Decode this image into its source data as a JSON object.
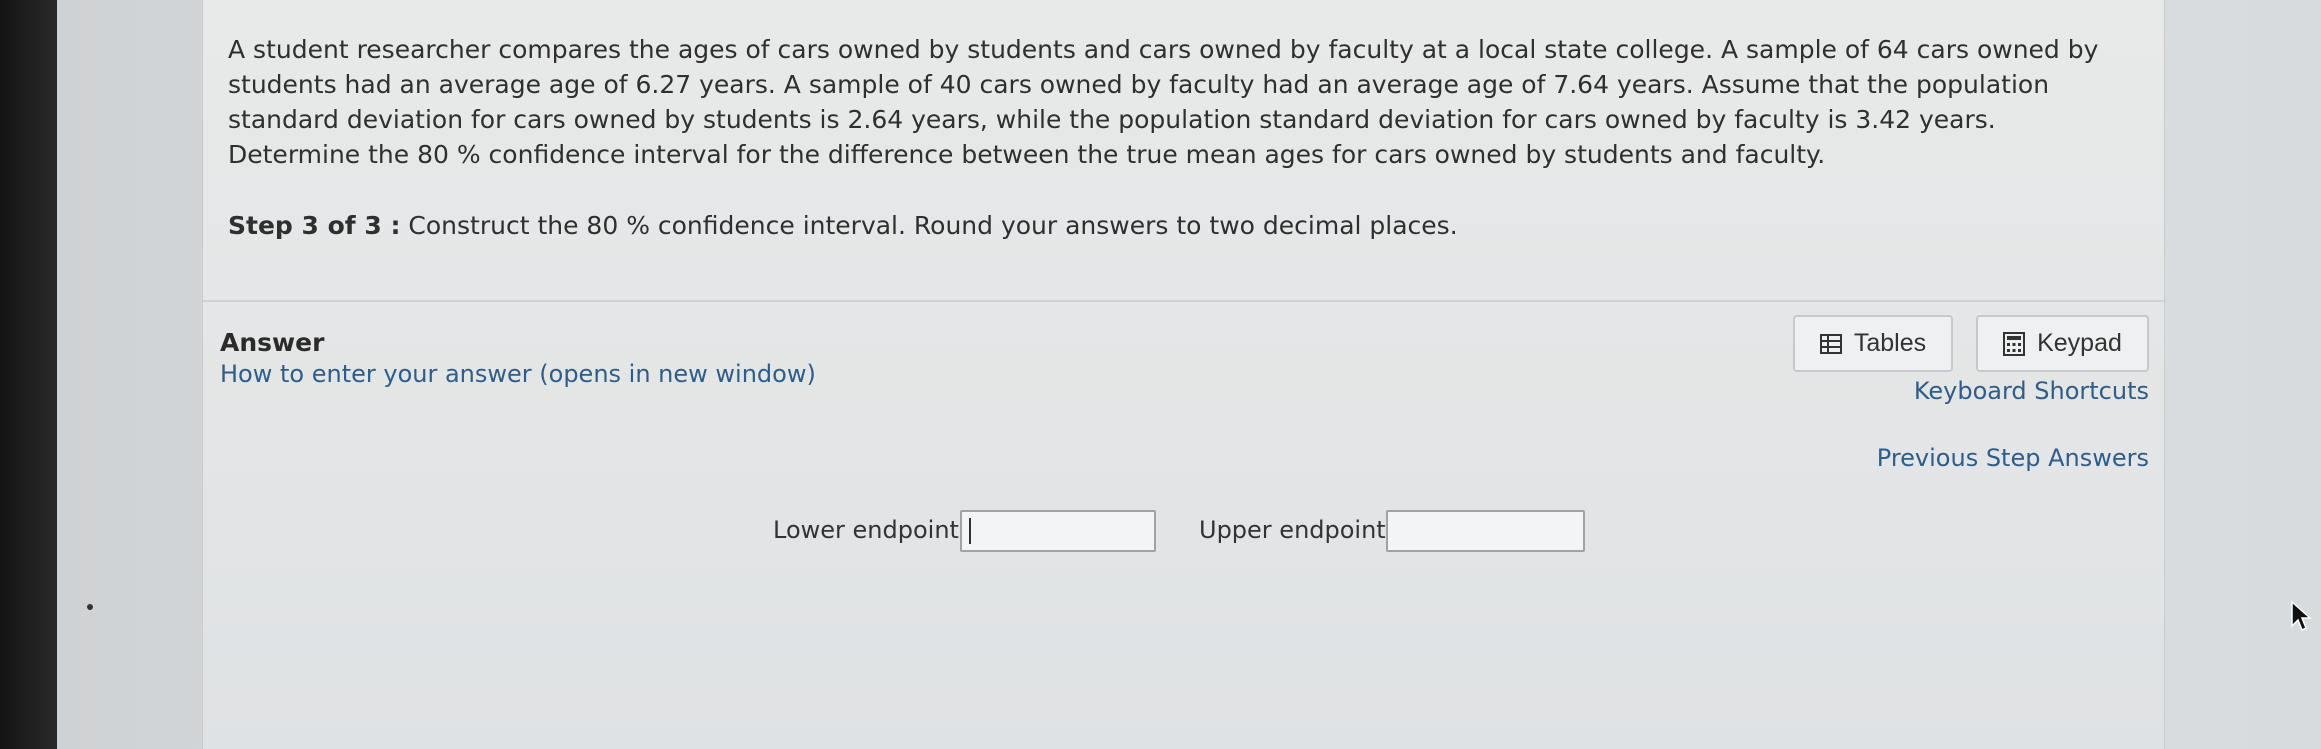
{
  "question": {
    "text": "A student researcher compares the ages of cars owned by students and cars owned by faculty at a local state college.  A sample of 64 cars owned by students had an average age of 6.27 years.  A sample of 40 cars owned by faculty had an average age of 7.64 years.  Assume that the population standard deviation for cars owned by students is 2.64 years, while the population standard deviation for cars owned by faculty is 3.42 years.  Determine the 80 %  confidence interval for the difference between the true mean ages for cars owned by students and faculty.",
    "step_label": "Step 3 of 3 :",
    "step_text": " Construct the 80 %  confidence interval. Round your answers to two decimal places."
  },
  "answer": {
    "title": "Answer",
    "how_to_link": "How to enter your answer (opens in new window)",
    "tables_label": "Tables",
    "keypad_label": "Keypad",
    "keyboard_shortcuts": "Keyboard Shortcuts",
    "previous_step_answers": "Previous Step Answers",
    "lower_label": "Lower endpoint:",
    "lower_value": "",
    "upper_label": "Upper endpoint:",
    "upper_value": ""
  },
  "icons": {
    "tables": "table-grid-icon",
    "keypad": "calculator-keypad-icon",
    "cursor": "mouse-pointer-icon"
  },
  "colors": {
    "link": "#2e5d8a",
    "panel": "#e6e8e9",
    "text": "#2f2f2f"
  }
}
